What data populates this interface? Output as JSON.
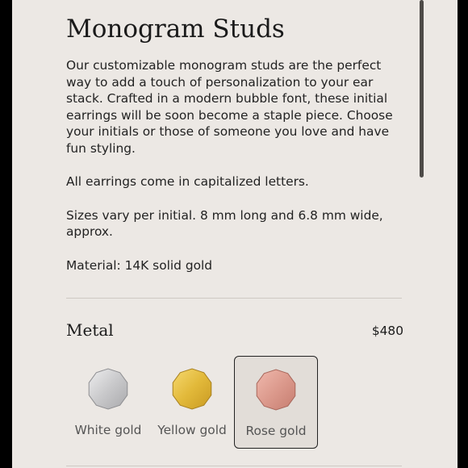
{
  "product": {
    "title": "Monogram Studs",
    "description": [
      "Our customizable monogram studs are the perfect way to add a touch of personalization to your ear stack. Crafted in a modern bubble font, these initial earrings will be soon become a staple piece. Choose your initials or those of someone you love and have fun styling.",
      "All earrings come in capitalized letters.",
      "Sizes vary per initial. 8 mm long and 6.8 mm wide, approx.",
      "Material: 14K solid gold"
    ]
  },
  "metal": {
    "label": "Metal",
    "price": "$480",
    "options": [
      {
        "label": "White gold",
        "color": "#c9c9cb",
        "selected": false
      },
      {
        "label": "Yellow gold",
        "color": "#e2b93a",
        "selected": false
      },
      {
        "label": "Rose gold",
        "color": "#dc9a8d",
        "selected": true
      }
    ]
  }
}
